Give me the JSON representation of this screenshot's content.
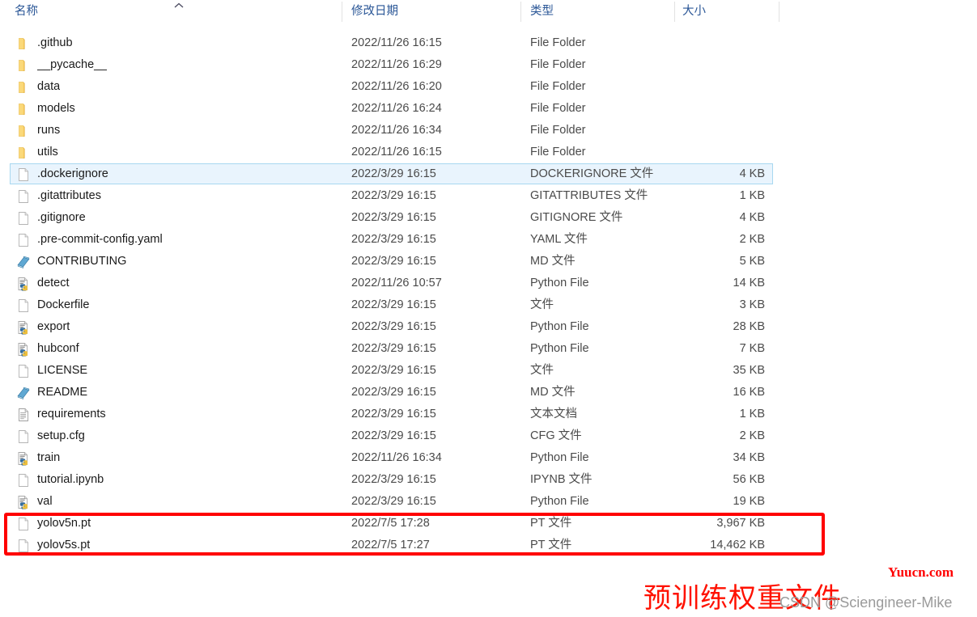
{
  "columns": {
    "name": "名称",
    "date_modified": "修改日期",
    "type": "类型",
    "size": "大小",
    "sort_icon": "sort-ascending-caret-icon"
  },
  "rows": [
    {
      "icon": "folder-icon",
      "name": ".github",
      "date": "2022/11/26 16:15",
      "type": "File Folder",
      "size": "",
      "selected": false
    },
    {
      "icon": "folder-icon",
      "name": "__pycache__",
      "date": "2022/11/26 16:29",
      "type": "File Folder",
      "size": "",
      "selected": false
    },
    {
      "icon": "folder-icon",
      "name": "data",
      "date": "2022/11/26 16:20",
      "type": "File Folder",
      "size": "",
      "selected": false
    },
    {
      "icon": "folder-icon",
      "name": "models",
      "date": "2022/11/26 16:24",
      "type": "File Folder",
      "size": "",
      "selected": false
    },
    {
      "icon": "folder-icon",
      "name": "runs",
      "date": "2022/11/26 16:34",
      "type": "File Folder",
      "size": "",
      "selected": false
    },
    {
      "icon": "folder-icon",
      "name": "utils",
      "date": "2022/11/26 16:15",
      "type": "File Folder",
      "size": "",
      "selected": false
    },
    {
      "icon": "blank-file-icon",
      "name": ".dockerignore",
      "date": "2022/3/29 16:15",
      "type": "DOCKERIGNORE 文件",
      "size": "4 KB",
      "selected": true
    },
    {
      "icon": "blank-file-icon",
      "name": ".gitattributes",
      "date": "2022/3/29 16:15",
      "type": "GITATTRIBUTES 文件",
      "size": "1 KB",
      "selected": false
    },
    {
      "icon": "blank-file-icon",
      "name": ".gitignore",
      "date": "2022/3/29 16:15",
      "type": "GITIGNORE 文件",
      "size": "4 KB",
      "selected": false
    },
    {
      "icon": "blank-file-icon",
      "name": ".pre-commit-config.yaml",
      "date": "2022/3/29 16:15",
      "type": "YAML 文件",
      "size": "2 KB",
      "selected": false
    },
    {
      "icon": "markdown-icon",
      "name": "CONTRIBUTING",
      "date": "2022/3/29 16:15",
      "type": "MD 文件",
      "size": "5 KB",
      "selected": false
    },
    {
      "icon": "python-file-icon",
      "name": "detect",
      "date": "2022/11/26 10:57",
      "type": "Python File",
      "size": "14 KB",
      "selected": false
    },
    {
      "icon": "blank-file-icon",
      "name": "Dockerfile",
      "date": "2022/3/29 16:15",
      "type": "文件",
      "size": "3 KB",
      "selected": false
    },
    {
      "icon": "python-file-icon",
      "name": "export",
      "date": "2022/3/29 16:15",
      "type": "Python File",
      "size": "28 KB",
      "selected": false
    },
    {
      "icon": "python-file-icon",
      "name": "hubconf",
      "date": "2022/3/29 16:15",
      "type": "Python File",
      "size": "7 KB",
      "selected": false
    },
    {
      "icon": "blank-file-icon",
      "name": "LICENSE",
      "date": "2022/3/29 16:15",
      "type": "文件",
      "size": "35 KB",
      "selected": false
    },
    {
      "icon": "markdown-icon",
      "name": "README",
      "date": "2022/3/29 16:15",
      "type": "MD 文件",
      "size": "16 KB",
      "selected": false
    },
    {
      "icon": "text-file-icon",
      "name": "requirements",
      "date": "2022/3/29 16:15",
      "type": "文本文档",
      "size": "1 KB",
      "selected": false
    },
    {
      "icon": "blank-file-icon",
      "name": "setup.cfg",
      "date": "2022/3/29 16:15",
      "type": "CFG 文件",
      "size": "2 KB",
      "selected": false
    },
    {
      "icon": "python-file-icon",
      "name": "train",
      "date": "2022/11/26 16:34",
      "type": "Python File",
      "size": "34 KB",
      "selected": false
    },
    {
      "icon": "blank-file-icon",
      "name": "tutorial.ipynb",
      "date": "2022/3/29 16:15",
      "type": "IPYNB 文件",
      "size": "56 KB",
      "selected": false
    },
    {
      "icon": "python-file-icon",
      "name": "val",
      "date": "2022/3/29 16:15",
      "type": "Python File",
      "size": "19 KB",
      "selected": false
    },
    {
      "icon": "blank-file-icon",
      "name": "yolov5n.pt",
      "date": "2022/7/5 17:28",
      "type": "PT 文件",
      "size": "3,967 KB",
      "selected": false
    },
    {
      "icon": "blank-file-icon",
      "name": "yolov5s.pt",
      "date": "2022/7/5 17:27",
      "type": "PT 文件",
      "size": "14,462 KB",
      "selected": false
    }
  ],
  "annotations": {
    "caption": "预训练权重文件",
    "box_color": "#ff0000",
    "caption_color": "#ff1100"
  },
  "watermarks": {
    "csdn": "CSDN @Sciengineer-Mike",
    "site": "Yuucn.com",
    "site_color": "#ff0000"
  }
}
